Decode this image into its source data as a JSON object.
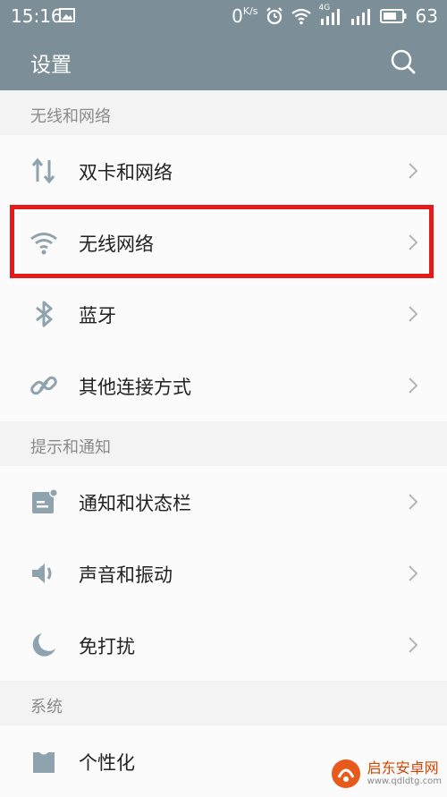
{
  "status_bar": {
    "time": "15:16",
    "net_speed": "0",
    "net_speed_unit": "K/s",
    "signal_label": "4G",
    "battery": "63"
  },
  "app_bar": {
    "title": "设置"
  },
  "sections": [
    {
      "title": "无线和网络",
      "items": [
        {
          "label": "双卡和网络",
          "icon": "dual-sim-icon"
        },
        {
          "label": "无线网络",
          "icon": "wifi-icon"
        },
        {
          "label": "蓝牙",
          "icon": "bluetooth-icon"
        },
        {
          "label": "其他连接方式",
          "icon": "link-icon"
        }
      ]
    },
    {
      "title": "提示和通知",
      "items": [
        {
          "label": "通知和状态栏",
          "icon": "notification-icon"
        },
        {
          "label": "声音和振动",
          "icon": "speaker-icon"
        },
        {
          "label": "免打扰",
          "icon": "moon-icon"
        }
      ]
    },
    {
      "title": "系统",
      "items": [
        {
          "label": "个性化",
          "icon": "personalize-icon"
        }
      ]
    }
  ],
  "watermark": {
    "name": "启东安卓网",
    "url": "www.qdldtg.com"
  },
  "colors": {
    "header_bg": "#7c8f99",
    "icon_color": "#8fa3ae",
    "highlight": "#e31b1b"
  }
}
